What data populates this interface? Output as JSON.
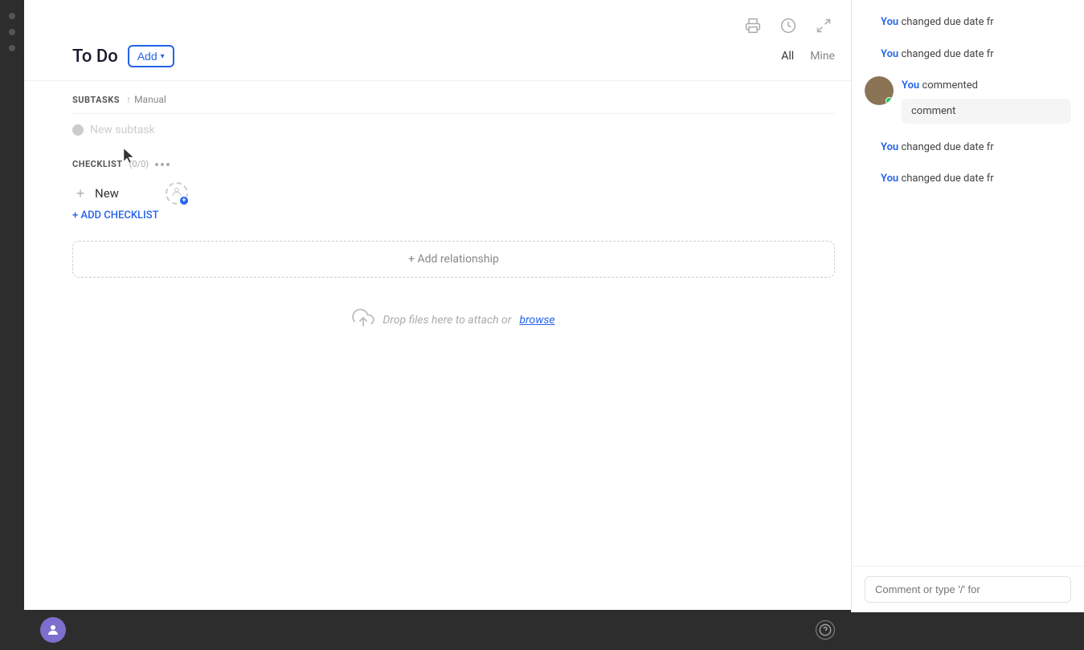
{
  "toolbar": {
    "print_icon": "🖨",
    "history_icon": "🕐",
    "expand_icon": "⤢"
  },
  "task": {
    "title": "To Do",
    "add_button_label": "Add"
  },
  "filters": {
    "all_label": "All",
    "mine_label": "Mine"
  },
  "subtasks": {
    "section_label": "SUBTASKS",
    "sort_label": "Manual",
    "new_subtask_placeholder": "New subtask"
  },
  "checklist": {
    "section_label": "CHECKLIST",
    "count_label": "(0/0)",
    "new_item_text": "New",
    "add_checklist_label": "+ ADD CHECKLIST"
  },
  "relationship": {
    "add_label": "+ Add relationship"
  },
  "dropzone": {
    "text": "Drop files here to attach or",
    "browse_label": "browse"
  },
  "activity": {
    "items": [
      {
        "user": "You",
        "action": "changed due date fr"
      },
      {
        "user": "You",
        "action": "changed due date fr"
      },
      {
        "user": "You",
        "action": "commented"
      },
      {
        "user": "You",
        "action": "changed due date fr"
      },
      {
        "user": "You",
        "action": "changed due date fr"
      }
    ],
    "comment_value": "comment"
  },
  "comment_input": {
    "placeholder": "Comment or type '/' for"
  }
}
